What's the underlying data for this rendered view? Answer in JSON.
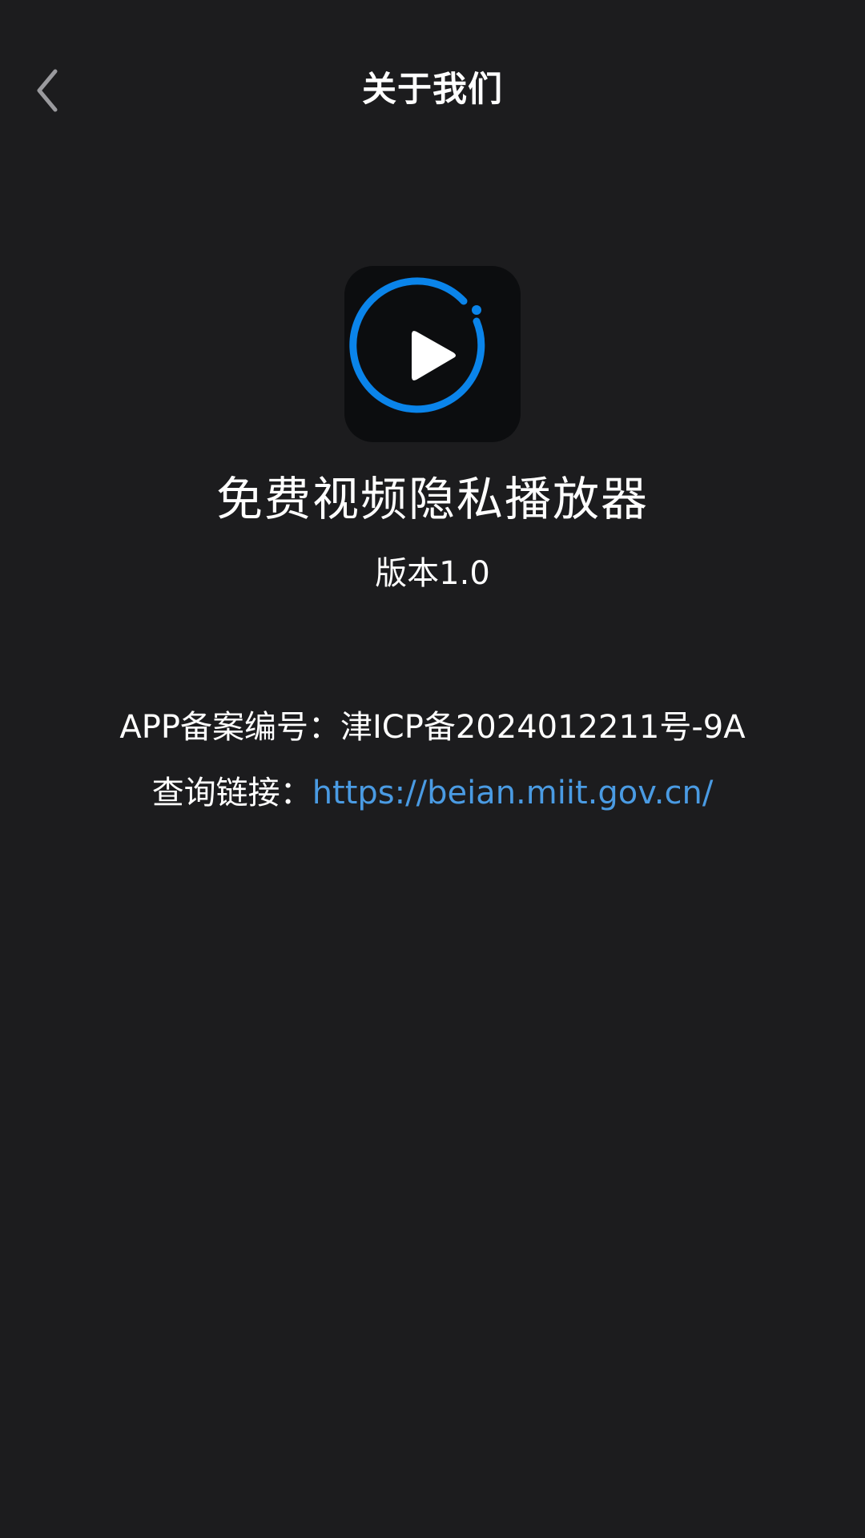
{
  "colors": {
    "background": "#1c1c1e",
    "accent": "#0a84ea",
    "link": "#4a9be3",
    "text": "#ffffff"
  },
  "nav": {
    "back_icon": "chevron-left-icon",
    "title": "关于我们"
  },
  "app": {
    "icon": "play-circle-icon",
    "name": "免费视频隐私播放器",
    "version": "版本1.0"
  },
  "filing": {
    "label": "APP备案编号：",
    "number": "津ICP备2024012211号-9A"
  },
  "query": {
    "label": "查询链接：",
    "url": "https://beian.miit.gov.cn/"
  }
}
